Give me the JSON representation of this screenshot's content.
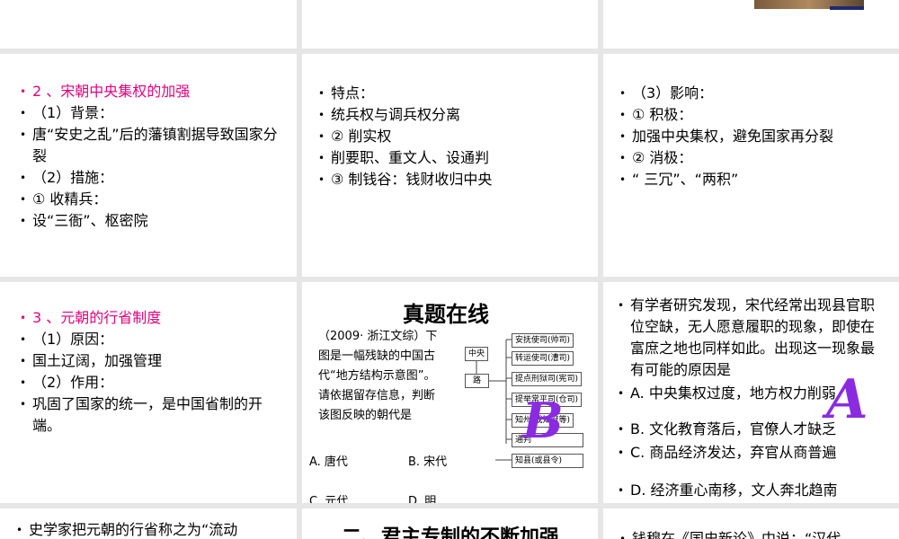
{
  "slide2": {
    "items": [
      "2 、宋朝中央集权的加强",
      "（1）背景：",
      "唐“安史之乱”后的藩镇割据导致国家分裂",
      "（2）措施：",
      "① 收精兵：",
      "设“三衙”、枢密院"
    ]
  },
  "slide3": {
    "items": [
      "特点：",
      "统兵权与调兵权分离",
      "② 削实权",
      "削要职、重文人、设通判",
      "③ 制钱谷：钱财收归中央"
    ]
  },
  "slide4": {
    "items": [
      "（3）影响：",
      "① 积极：",
      "加强中央集权，避免国家再分裂",
      "② 消极：",
      "“ 三冗”、“两积”"
    ]
  },
  "slide5": {
    "items": [
      "3 、元朝的行省制度",
      "（1）原因：",
      "国土辽阔，加强管理",
      "（2）作用：",
      "巩固了国家的统一，是中国省制的开端。"
    ]
  },
  "slide6": {
    "title": "真题在线",
    "question": "（2009· 浙江文综）下图是一幅残缺的中国古代“地方结构示意图”。请依据留存信息，判断该图反映的朝代是",
    "options": [
      "A. 唐代",
      "B. 宋代",
      "C. 元代",
      "D. 明"
    ],
    "diagram": {
      "center": "中央",
      "road": "路",
      "boxes": [
        "安抚使司(帅司)",
        "转运使司(漕司)",
        "提点刑狱司(宪司)",
        "提举常平司(仓司)",
        "知州(或知府等)",
        "通判",
        "知县(或县令)"
      ]
    },
    "mark": "B"
  },
  "slide7": {
    "items": [
      "有学者研究发现，宋代经常出现县官职位空缺，无人愿意履职的现象，即使在富庶之地也同样如此。出现这一现象最有可能的原因是",
      "A. 中央集权过度，地方权力削弱",
      "B. 文化教育落后，官僚人才缺乏",
      "C. 商品经济发达，弃官从商普遍",
      "D. 经济重心南移，文人奔北趋南"
    ],
    "mark": "A"
  },
  "slide8": {
    "items": [
      "史学家把元朝的行省称之为“流动"
    ]
  },
  "slide9": {
    "title": "二、君主专制的不断加强"
  },
  "slide10": {
    "items": [
      "钱穆在《国史新论》中说：“汉代"
    ]
  }
}
